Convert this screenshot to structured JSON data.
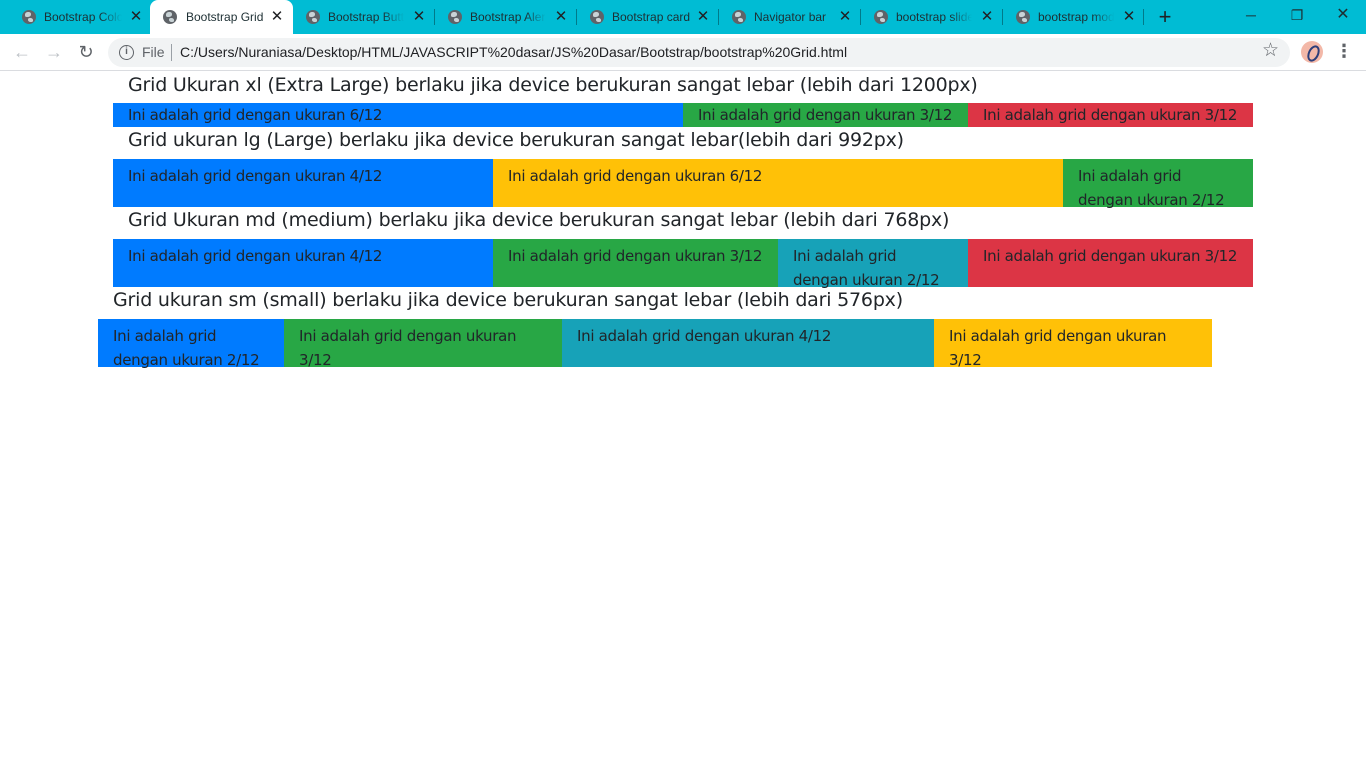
{
  "browser": {
    "tabs": [
      {
        "title": "Bootstrap Colo",
        "active": false
      },
      {
        "title": "Bootstrap Grid",
        "active": true
      },
      {
        "title": "Bootstrap Butt",
        "active": false
      },
      {
        "title": "Bootstrap Aler",
        "active": false
      },
      {
        "title": "Bootstrap card",
        "active": false
      },
      {
        "title": "Navigator bar",
        "active": false
      },
      {
        "title": "bootstrap slide",
        "active": false
      },
      {
        "title": "bootstrap mod",
        "active": false
      }
    ],
    "new_tab": "+",
    "window": {
      "minimize": "─",
      "restore": "❐",
      "close": "✕"
    },
    "nav": {
      "back": "←",
      "forward": "→",
      "reload": "↻"
    },
    "address": {
      "scheme_label": "File",
      "url": "C:/Users/Nuraniasa/Desktop/HTML/JAVASCRIPT%20dasar/JS%20Dasar/Bootstrap/bootstrap%20Grid.html"
    },
    "icons": {
      "star": "☆",
      "menu": "⋮",
      "close": "✕",
      "info": "i"
    }
  },
  "page": {
    "sections": [
      {
        "heading": "Grid Ukuran xl (Extra Large) berlaku jika device berukuran sangat lebar (lebih dari 1200px)",
        "columns": [
          {
            "text": "Ini adalah grid dengan ukuran 6/12",
            "color": "#007bff"
          },
          {
            "text": "Ini adalah grid dengan ukuran 3/12",
            "color": "#28a745"
          },
          {
            "text": "Ini adalah grid dengan ukuran 3/12",
            "color": "#dc3545"
          }
        ]
      },
      {
        "heading": "Grid ukuran lg (Large) berlaku jika device berukuran sangat lebar(lebih dari 992px)",
        "columns": [
          {
            "text": "Ini adalah grid dengan ukuran 4/12",
            "color": "#007bff"
          },
          {
            "text": "Ini adalah grid dengan ukuran 6/12",
            "color": "#ffc107"
          },
          {
            "text": "Ini adalah grid dengan ukuran 2/12",
            "color": "#28a745"
          }
        ]
      },
      {
        "heading": "Grid Ukuran md (medium) berlaku jika device berukuran sangat lebar (lebih dari 768px)",
        "columns": [
          {
            "text": "Ini adalah grid dengan ukuran 4/12",
            "color": "#007bff"
          },
          {
            "text": "Ini adalah grid dengan ukuran 3/12",
            "color": "#28a745"
          },
          {
            "text": "Ini adalah grid dengan ukuran 2/12",
            "color": "#17a2b8"
          },
          {
            "text": "Ini adalah grid dengan ukuran 3/12",
            "color": "#dc3545"
          }
        ]
      },
      {
        "heading": "Grid ukuran sm (small) berlaku jika device berukuran sangat lebar (lebih dari 576px)",
        "columns": [
          {
            "text": "Ini adalah grid dengan ukuran 2/12",
            "color": "#007bff"
          },
          {
            "text": "Ini adalah grid dengan ukuran 3/12",
            "color": "#28a745"
          },
          {
            "text": "Ini adalah grid dengan ukuran 4/12",
            "color": "#17a2b8"
          },
          {
            "text": "Ini adalah grid dengan ukuran 3/12",
            "color": "#ffc107"
          }
        ]
      }
    ]
  }
}
